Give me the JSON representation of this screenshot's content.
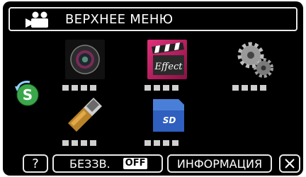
{
  "header": {
    "title": "ВЕРХНЕЕ МЕНЮ",
    "mode_icon": "video-camera-icon"
  },
  "side": {
    "icon": "s-mode-switch-icon"
  },
  "tiles": [
    {
      "icon": "camera-lens-icon"
    },
    {
      "icon": "effect-icon"
    },
    {
      "icon": "settings-gears-icon"
    },
    {
      "icon": "hdmi-connection-icon"
    },
    {
      "icon": "sd-card-icon"
    }
  ],
  "footer": {
    "help_label": "?",
    "mute_label": "БЕЗЗВ.",
    "mute_state": "OFF",
    "info_label": "ИНФОРМАЦИЯ",
    "close_icon": "close-icon"
  },
  "colors": {
    "background": "#000000",
    "border": "#e8e8e8",
    "s_icon": "#3aa84a"
  }
}
